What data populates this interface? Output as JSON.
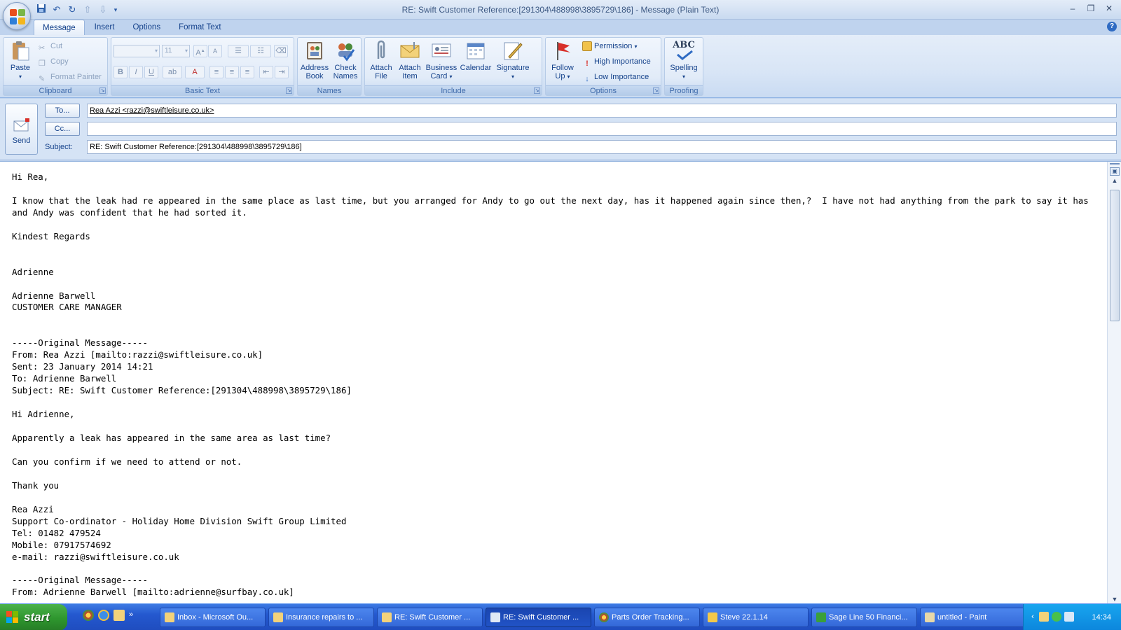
{
  "window": {
    "title": "RE: Swift Customer Reference:[291304\\488998\\3895729\\186] - Message (Plain Text)"
  },
  "ribbon": {
    "tabs": [
      "Message",
      "Insert",
      "Options",
      "Format Text"
    ],
    "clipboard": {
      "label": "Clipboard",
      "paste": "Paste",
      "cut": "Cut",
      "copy": "Copy",
      "format_painter": "Format Painter"
    },
    "basic_text": {
      "label": "Basic Text",
      "font_size": "11",
      "bold": "B",
      "italic": "I",
      "underline": "U"
    },
    "names": {
      "label": "Names",
      "address_book_1": "Address",
      "address_book_2": "Book",
      "check_names_1": "Check",
      "check_names_2": "Names"
    },
    "include": {
      "label": "Include",
      "attach_file_1": "Attach",
      "attach_file_2": "File",
      "attach_item_1": "Attach",
      "attach_item_2": "Item",
      "business_card_1": "Business",
      "business_card_2": "Card",
      "calendar": "Calendar",
      "signature": "Signature"
    },
    "options": {
      "label": "Options",
      "follow_up_1": "Follow",
      "follow_up_2": "Up",
      "permission": "Permission",
      "high_importance": "High Importance",
      "low_importance": "Low Importance"
    },
    "proofing": {
      "label": "Proofing",
      "spelling": "Spelling",
      "abc": "ABC"
    }
  },
  "header": {
    "send": "Send",
    "to_button": "To...",
    "cc_button": "Cc...",
    "subject_label": "Subject:",
    "to_value": "Rea Azzi <razzi@swiftleisure.co.uk>",
    "cc_value": "",
    "subject_value": "RE: Swift Customer Reference:[291304\\488998\\3895729\\186]"
  },
  "body": {
    "lines": [
      "Hi Rea,",
      "",
      "I know that the leak had re appeared in the same place as last time, but you arranged for Andy to go out the next day, has it happened again since then,?  I have not had anything from the park to say it has and Andy was confident that he had sorted it.",
      "",
      "Kindest Regards",
      "",
      "",
      "Adrienne",
      "",
      "Adrienne Barwell",
      "CUSTOMER CARE MANAGER",
      "",
      "",
      "-----Original Message-----",
      "From: Rea Azzi [mailto:razzi@swiftleisure.co.uk]",
      "Sent: 23 January 2014 14:21",
      "To: Adrienne Barwell",
      "Subject: RE: Swift Customer Reference:[291304\\488998\\3895729\\186]",
      "",
      "Hi Adrienne,",
      "",
      "Apparently a leak has appeared in the same area as last time?",
      "",
      "Can you confirm if we need to attend or not.",
      "",
      "Thank you",
      "",
      "Rea Azzi",
      "Support Co-ordinator - Holiday Home Division Swift Group Limited",
      "Tel: 01482 479524",
      "Mobile: 07917574692",
      "e-mail: razzi@swiftleisure.co.uk",
      "",
      "-----Original Message-----",
      "From: Adrienne Barwell [mailto:adrienne@surfbay.co.uk]"
    ]
  },
  "taskbar": {
    "start": "start",
    "items": [
      "Inbox - Microsoft Ou...",
      "Insurance repairs to ...",
      "RE: Swift Customer ...",
      "RE: Swift Customer ...",
      "Parts Order Tracking...",
      "Steve 22.1.14",
      "Sage Line 50 Financi...",
      "untitled - Paint"
    ],
    "clock": "14:34"
  },
  "colors": {
    "ribbon_text": "#15428b",
    "taskbar": "#2458cf",
    "start_green": "#2e962e",
    "tray": "#0c86dc"
  }
}
